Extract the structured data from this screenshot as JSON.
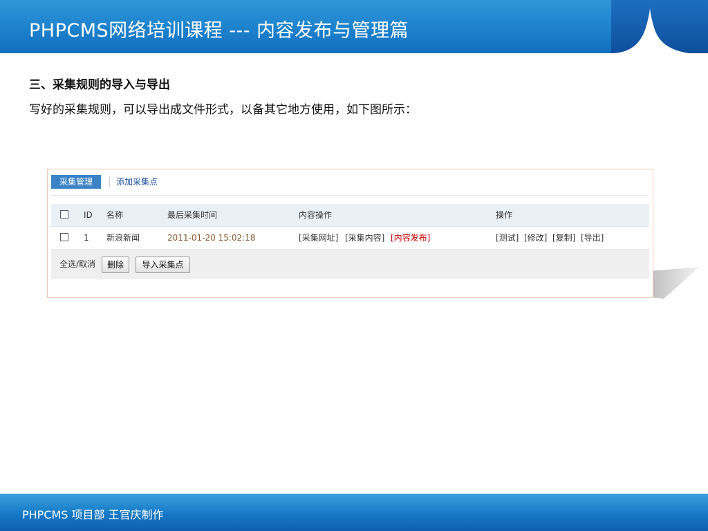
{
  "header": {
    "title": "PHPCMS网络培训课程 ---  内容发布与管理篇"
  },
  "content": {
    "heading": "三、采集规则的导入与导出",
    "text": "写好的采集规则，可以导出成文件形式，以备其它地方使用，如下图所示："
  },
  "screenshot": {
    "tabs": {
      "active": "采集管理",
      "add_link": "添加采集点"
    },
    "columns": {
      "id": "ID",
      "name": "名称",
      "last_time": "最后采集时间",
      "content_ops": "内容操作",
      "ops": "操作"
    },
    "rows": [
      {
        "id": "1",
        "name": "新浪新闻",
        "last_time": "2011-01-20 15:02:18",
        "collect_url": "[采集网址]",
        "collect_content": "[采集内容]",
        "publish": "[内容发布]",
        "test": "[测试]",
        "edit": "[修改]",
        "copy": "[复制]",
        "export": "[导出]"
      }
    ],
    "footer": {
      "select_all": "全选/取消",
      "delete_button": "删除",
      "import_button": "导入采集点"
    },
    "colors": {
      "tab_active": "#3b83c6",
      "date_text": "#8a5a2f",
      "publish_text": "#cc0000"
    }
  },
  "bottom_bar": {
    "text": "PHPCMS 项目部 王官庆制作"
  }
}
